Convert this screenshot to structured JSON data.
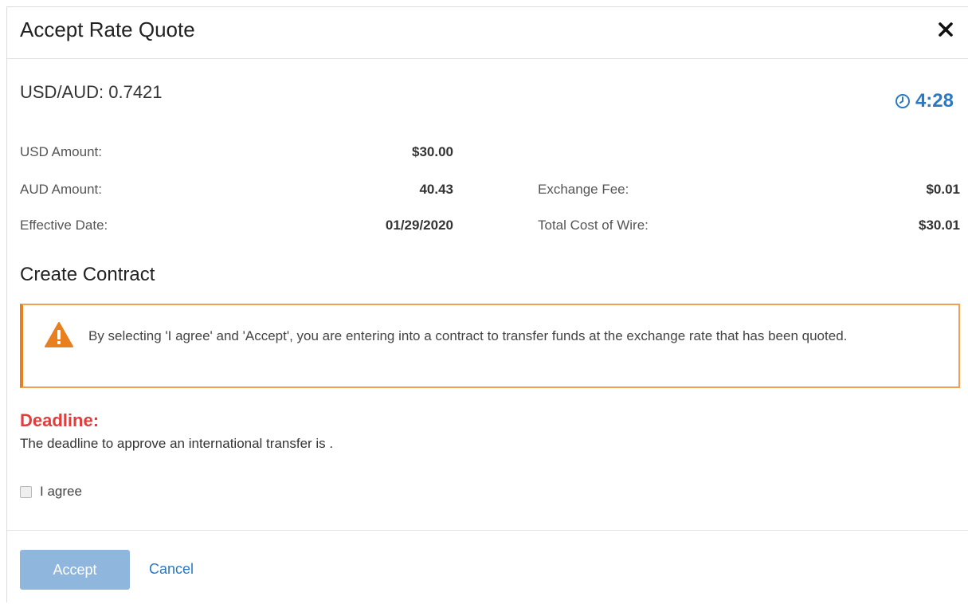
{
  "dialog": {
    "title": "Accept Rate Quote",
    "close_icon": "close-icon"
  },
  "quote": {
    "rate_text": "USD/AUD: 0.7421",
    "timer": "4:28",
    "timer_icon": "clock-icon",
    "accent_color": "#2a79c5"
  },
  "details": {
    "usd_amount_label": "USD Amount:",
    "usd_amount_value": "$30.00",
    "aud_amount_label": "AUD Amount:",
    "aud_amount_value": "40.43",
    "effective_date_label": "Effective Date:",
    "effective_date_value": "01/29/2020",
    "exchange_fee_label": "Exchange Fee:",
    "exchange_fee_value": "$0.01",
    "total_cost_label": "Total Cost of Wire:",
    "total_cost_value": "$30.01"
  },
  "contract": {
    "title": "Create Contract",
    "warning_icon": "warning-icon",
    "warning_color": "#e8801f",
    "warning_text": "By selecting 'I agree' and 'Accept', you are entering into a contract to transfer funds at the exchange rate that has been quoted."
  },
  "deadline": {
    "title": "Deadline:",
    "text": "The deadline to approve an international transfer is .",
    "color": "#e23c3c"
  },
  "agree": {
    "label": "I agree",
    "checked": false
  },
  "footer": {
    "accept_label": "Accept",
    "cancel_label": "Cancel"
  }
}
